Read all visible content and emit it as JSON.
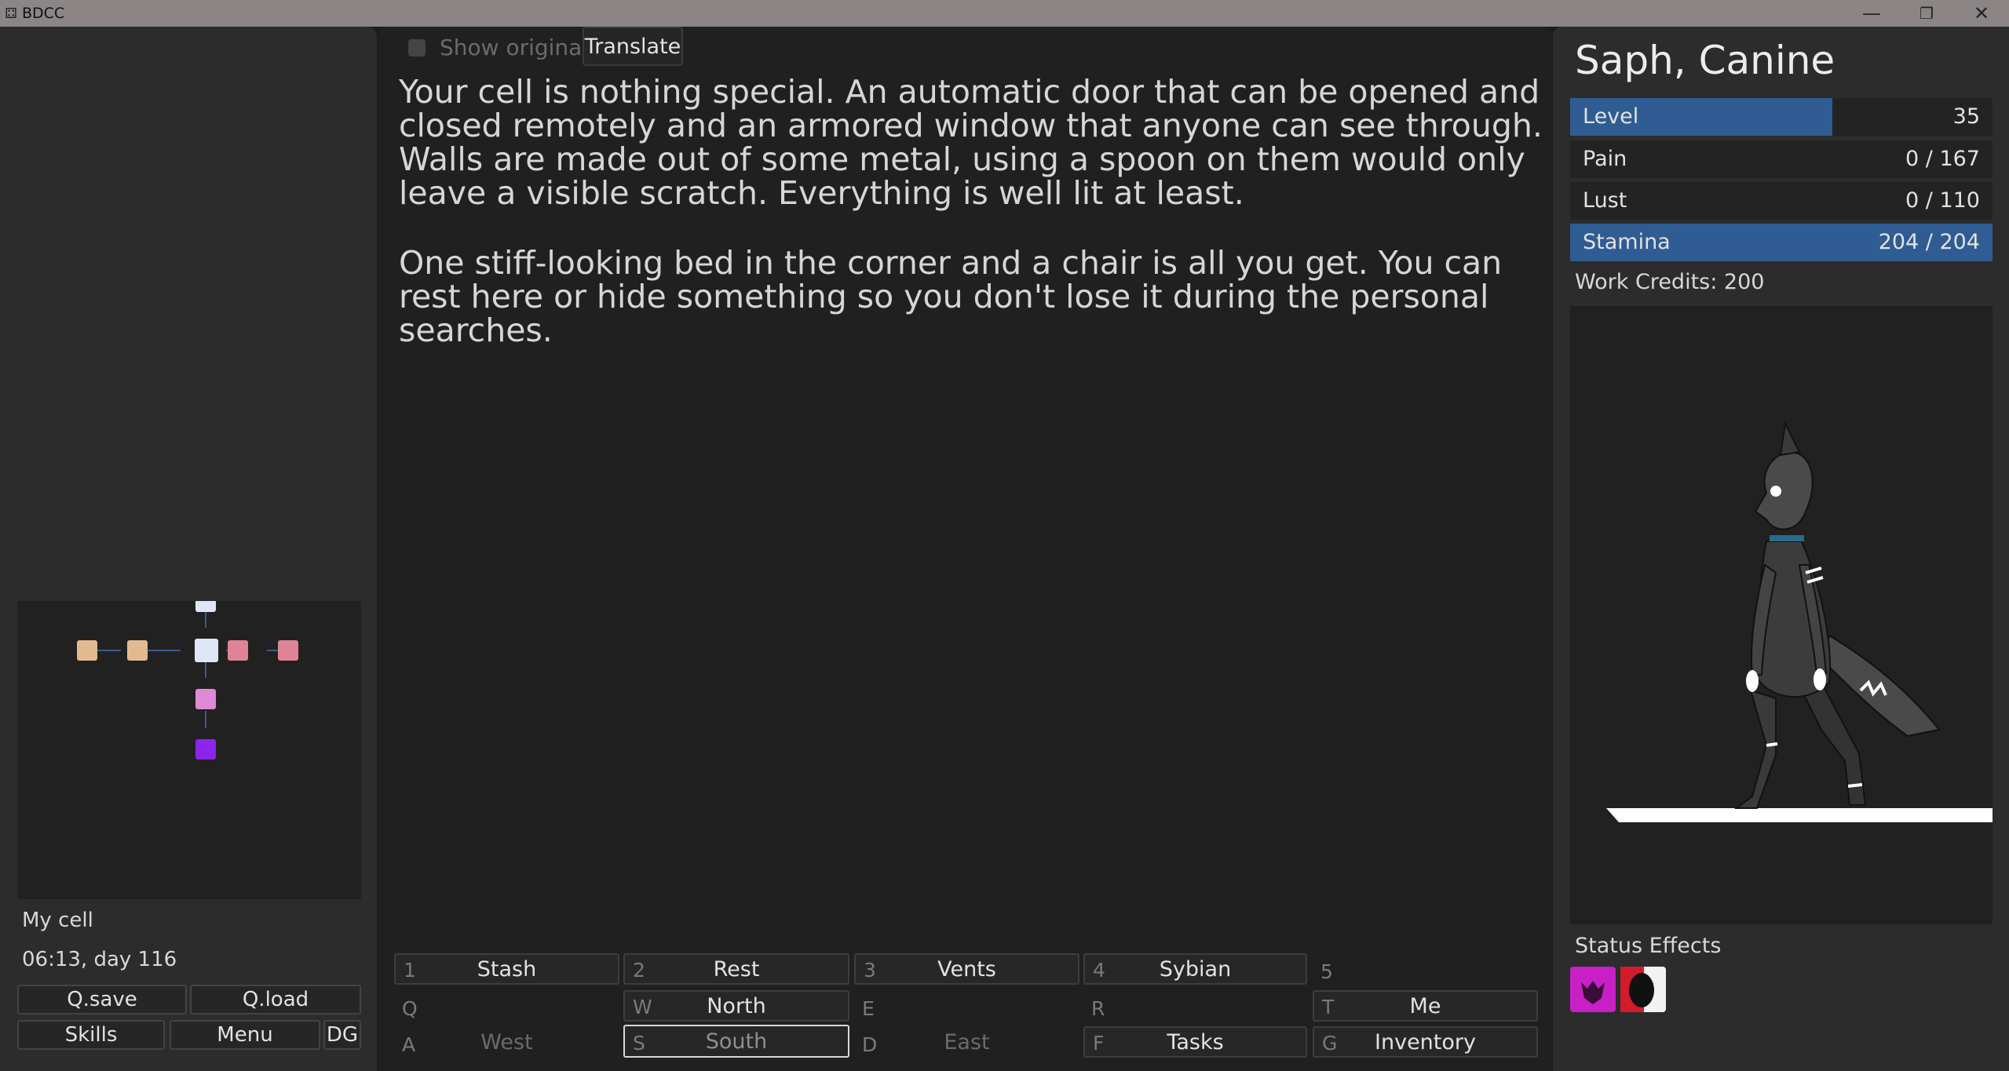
{
  "window": {
    "title": "BDCC",
    "controls": [
      "—",
      "❐",
      "✕"
    ]
  },
  "location": {
    "name": "My cell",
    "time": "06:13, day 116"
  },
  "left_buttons": {
    "qsave": "Q.save",
    "qload": "Q.load",
    "skills": "Skills",
    "menu": "Menu",
    "dg": "DG"
  },
  "minimap": {
    "rooms": [
      {
        "id": "top",
        "color": "#dfe6f6"
      },
      {
        "id": "w2",
        "color": "#e3b98f"
      },
      {
        "id": "w1",
        "color": "#e3b98f"
      },
      {
        "id": "center",
        "color": "#dfe6f6"
      },
      {
        "id": "e1",
        "color": "#de8496"
      },
      {
        "id": "e2",
        "color": "#de8496"
      },
      {
        "id": "s1",
        "color": "#e08ad7"
      },
      {
        "id": "s2",
        "color": "#8e23ec"
      }
    ],
    "link_color": "#3d5a8c"
  },
  "translate": {
    "show_original_label": "Show original",
    "button": "Translate"
  },
  "story": {
    "p1": "Your cell is nothing special. An automatic door that can be opened and closed remotely and an armored window that anyone can see through. Walls are made out of some metal, using a spoon on them would only leave a visible scratch. Everything is well lit at least.",
    "p2": "One stiff-looking bed in the corner and a chair is all you get. You can rest here or hide something so you don't lose it during the personal searches."
  },
  "actions": {
    "row1": [
      {
        "key": "1",
        "label": "Stash"
      },
      {
        "key": "2",
        "label": "Rest"
      },
      {
        "key": "3",
        "label": "Vents"
      },
      {
        "key": "4",
        "label": "Sybian"
      },
      {
        "key": "5",
        "label": ""
      }
    ],
    "row2": [
      {
        "key": "Q",
        "label": ""
      },
      {
        "key": "W",
        "label": "North"
      },
      {
        "key": "E",
        "label": ""
      },
      {
        "key": "R",
        "label": ""
      },
      {
        "key": "T",
        "label": "Me"
      }
    ],
    "row3": [
      {
        "key": "A",
        "label": "West"
      },
      {
        "key": "S",
        "label": "South"
      },
      {
        "key": "D",
        "label": "East"
      },
      {
        "key": "F",
        "label": "Tasks"
      },
      {
        "key": "G",
        "label": "Inventory"
      }
    ]
  },
  "character": {
    "name": "Saph, Canine",
    "stats": [
      {
        "name": "Level",
        "value": "35",
        "fill": 0.62
      },
      {
        "name": "Pain",
        "value": "0 / 167",
        "fill": 0
      },
      {
        "name": "Lust",
        "value": "0 / 110",
        "fill": 0
      },
      {
        "name": "Stamina",
        "value": "204 / 204",
        "fill": 1
      }
    ],
    "credits": "Work Credits: 200",
    "status_effects_title": "Status Effects",
    "status_effects": [
      {
        "icon": "demon-mark-icon",
        "color": "#c81fc7"
      },
      {
        "icon": "collar-icon",
        "color": "#d21c2b"
      }
    ]
  },
  "colors": {
    "accent": "#2e5c93"
  }
}
